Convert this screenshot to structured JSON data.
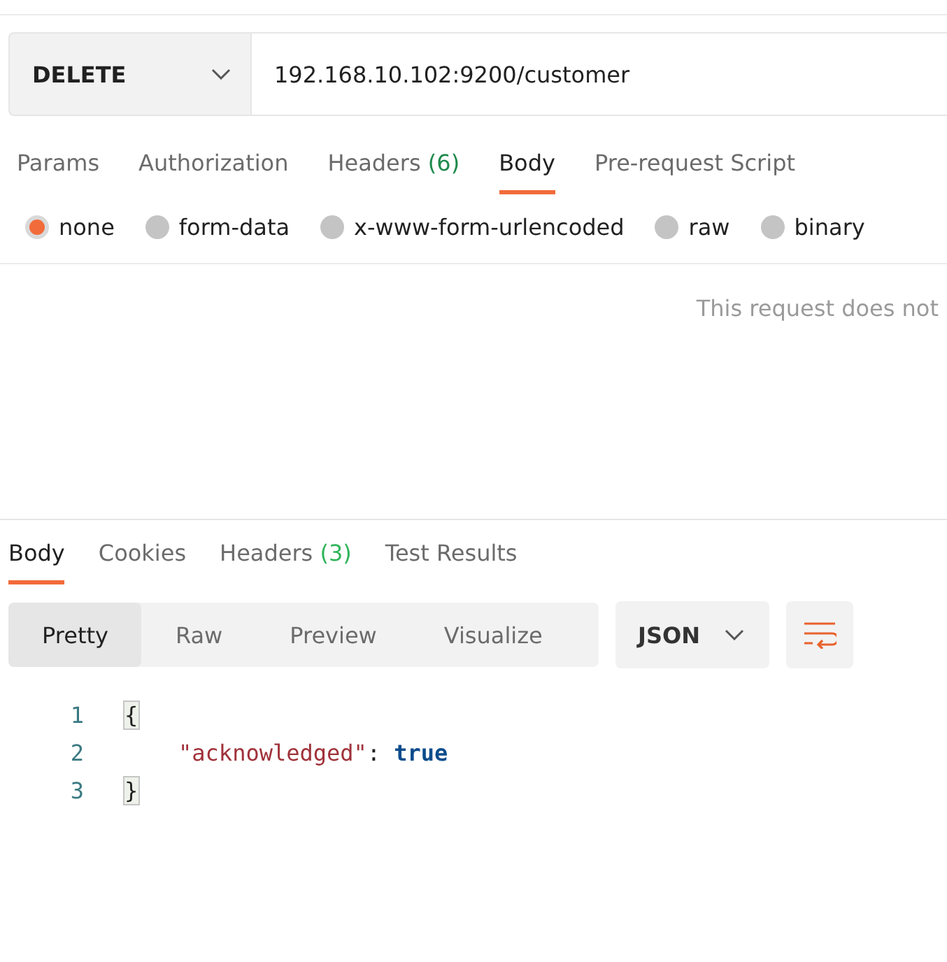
{
  "request": {
    "method": "DELETE",
    "url": "192.168.10.102:9200/customer"
  },
  "request_tabs": [
    {
      "label": "Params",
      "selected": false
    },
    {
      "label": "Authorization",
      "selected": false
    },
    {
      "label": "Headers",
      "count": "(6)",
      "selected": false
    },
    {
      "label": "Body",
      "selected": true
    },
    {
      "label": "Pre-request Script",
      "selected": false
    }
  ],
  "body_types": [
    {
      "label": "none",
      "selected": true
    },
    {
      "label": "form-data",
      "selected": false
    },
    {
      "label": "x-www-form-urlencoded",
      "selected": false
    },
    {
      "label": "raw",
      "selected": false
    },
    {
      "label": "binary",
      "selected": false
    }
  ],
  "body_message": "This request does not",
  "response_tabs": [
    {
      "label": "Body",
      "selected": true
    },
    {
      "label": "Cookies",
      "selected": false
    },
    {
      "label": "Headers",
      "count": "(3)",
      "selected": false
    },
    {
      "label": "Test Results",
      "selected": false
    }
  ],
  "view_modes": [
    {
      "label": "Pretty",
      "selected": true
    },
    {
      "label": "Raw",
      "selected": false
    },
    {
      "label": "Preview",
      "selected": false
    },
    {
      "label": "Visualize",
      "selected": false
    }
  ],
  "format": "JSON",
  "code_lines": [
    {
      "number": "1",
      "tokens": [
        {
          "text": "{",
          "kind": "bracket"
        }
      ]
    },
    {
      "number": "2",
      "kind": "member",
      "tokens": [
        {
          "text": "\"acknowledged\"",
          "kind": "key"
        },
        {
          "text": ": ",
          "kind": "punct"
        },
        {
          "text": "true",
          "kind": "keyword"
        }
      ]
    },
    {
      "number": "3",
      "tokens": [
        {
          "text": "}",
          "kind": "bracket"
        }
      ]
    }
  ]
}
